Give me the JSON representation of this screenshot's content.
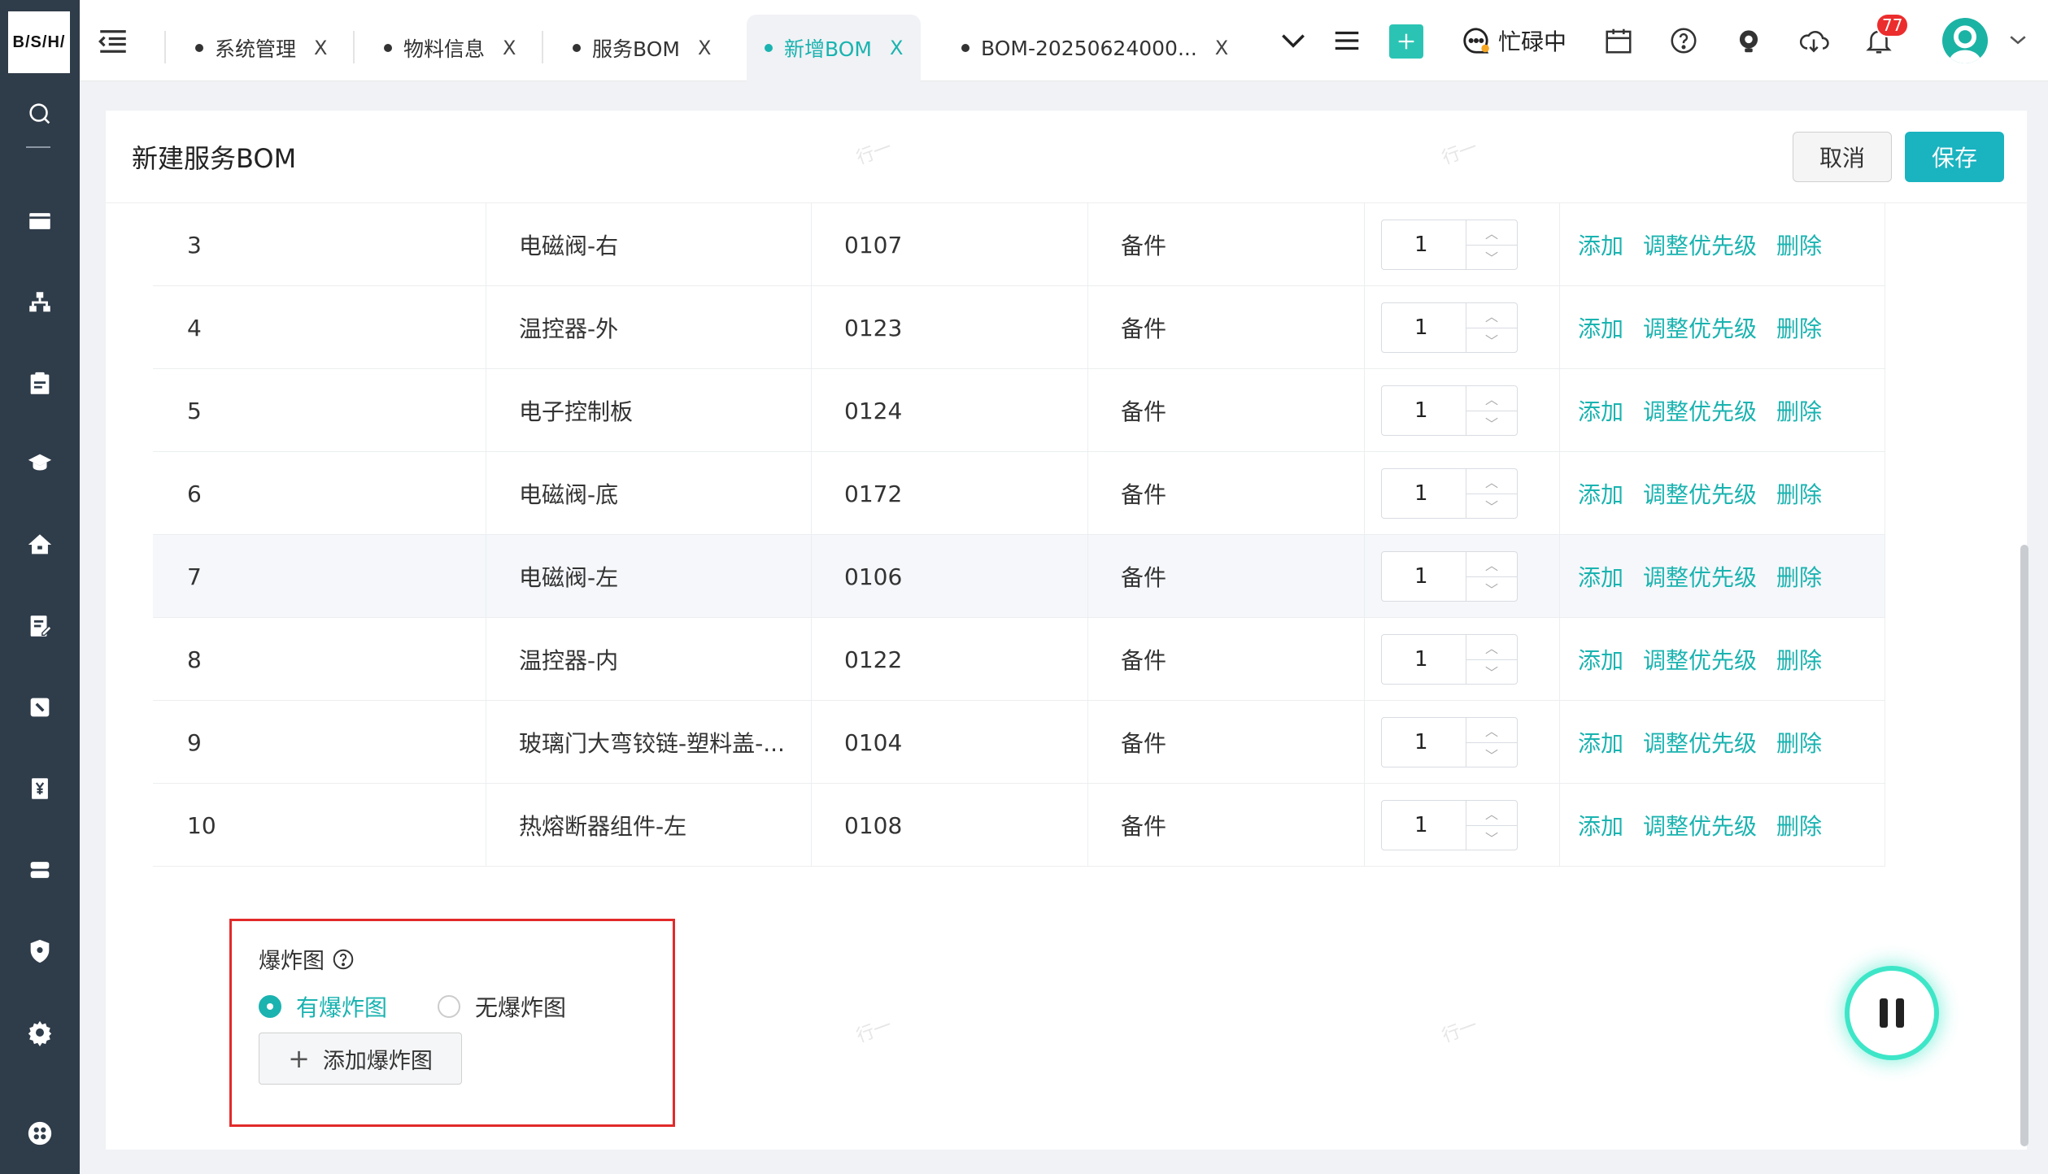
{
  "app": {
    "logo_text": "B/S/H/"
  },
  "tabs": [
    {
      "label": "系统管理",
      "close": "X"
    },
    {
      "label": "物料信息",
      "close": "X"
    },
    {
      "label": "服务BOM",
      "close": "X"
    },
    {
      "label": "新增BOM",
      "close": "X",
      "active": true
    },
    {
      "label": "BOM-20250624000...",
      "close": "X"
    }
  ],
  "header": {
    "status_label": "忙碌中",
    "notification_count": "77"
  },
  "page": {
    "title": "新建服务BOM",
    "cancel_label": "取消",
    "save_label": "保存"
  },
  "table": {
    "rows": [
      {
        "index": "3",
        "name": "电磁阀-右",
        "code": "0107",
        "type": "备件",
        "qty": "1"
      },
      {
        "index": "4",
        "name": "温控器-外",
        "code": "0123",
        "type": "备件",
        "qty": "1"
      },
      {
        "index": "5",
        "name": "电子控制板",
        "code": "0124",
        "type": "备件",
        "qty": "1"
      },
      {
        "index": "6",
        "name": "电磁阀-底",
        "code": "0172",
        "type": "备件",
        "qty": "1"
      },
      {
        "index": "7",
        "name": "电磁阀-左",
        "code": "0106",
        "type": "备件",
        "qty": "1"
      },
      {
        "index": "8",
        "name": "温控器-内",
        "code": "0122",
        "type": "备件",
        "qty": "1"
      },
      {
        "index": "9",
        "name": "玻璃门大弯铰链-塑料盖-...",
        "code": "0104",
        "type": "备件",
        "qty": "1"
      },
      {
        "index": "10",
        "name": "热熔断器组件-左",
        "code": "0108",
        "type": "备件",
        "qty": "1"
      }
    ],
    "actions": {
      "add": "添加",
      "priority": "调整优先级",
      "delete": "删除"
    }
  },
  "explode": {
    "label": "爆炸图",
    "option_yes": "有爆炸图",
    "option_no": "无爆炸图",
    "add_button": "添加爆炸图",
    "add_plus": "+",
    "selected": "yes"
  },
  "watermark_text": "行一",
  "colors": {
    "accent": "#1ab3b0",
    "sidebar": "#2f3c4a",
    "badge": "#ec2d2d",
    "highlight_border": "#e22a2a"
  }
}
